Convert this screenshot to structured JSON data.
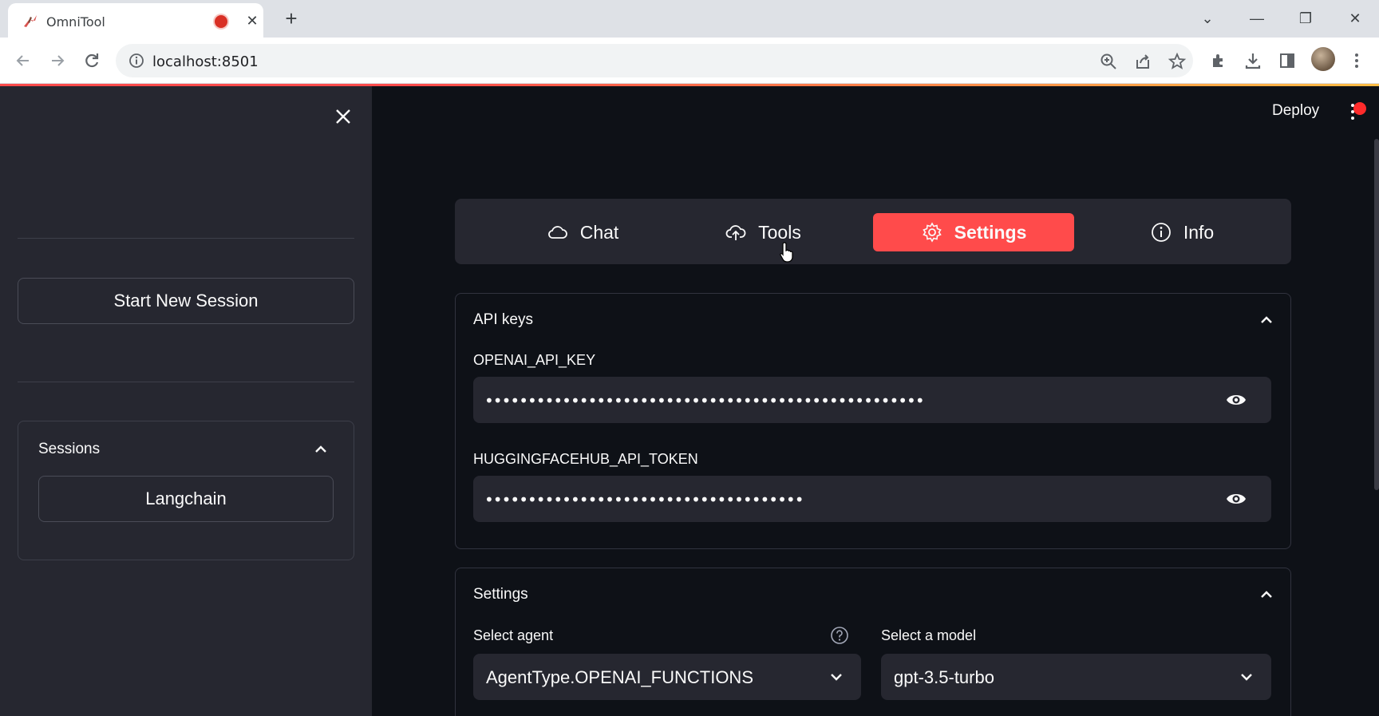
{
  "browser": {
    "tab_title": "OmniTool",
    "tab_close": "✕",
    "new_tab": "+",
    "url": "localhost:8501",
    "window_controls": {
      "tab_search": "⌄",
      "minimize": "—",
      "restore": "❐",
      "close": "✕"
    }
  },
  "sidebar": {
    "close_icon": "close-icon",
    "start_new_session": "Start New Session",
    "sessions": {
      "title": "Sessions",
      "items": [
        "Langchain"
      ]
    }
  },
  "header": {
    "deploy": "Deploy"
  },
  "nav": {
    "active": "Settings",
    "items": [
      {
        "label": "Chat",
        "icon": "cloud-icon"
      },
      {
        "label": "Tools",
        "icon": "cloud-upload-icon"
      },
      {
        "label": "Settings",
        "icon": "gear-icon"
      },
      {
        "label": "Info",
        "icon": "info-icon"
      }
    ]
  },
  "api_keys": {
    "title": "API keys",
    "openai": {
      "label": "OPENAI_API_KEY",
      "value": "•••••••••••••••••••••••••••••••••••••••••••••••••••"
    },
    "huggingface": {
      "label": "HUGGINGFACEHUB_API_TOKEN",
      "value": "•••••••••••••••••••••••••••••••••••••"
    }
  },
  "settings": {
    "title": "Settings",
    "agent": {
      "label": "Select agent",
      "value": "AgentType.OPENAI_FUNCTIONS"
    },
    "model": {
      "label": "Select a model",
      "value": "gpt-3.5-turbo"
    }
  },
  "colors": {
    "accent": "#ff4b4b",
    "background": "#0e1117",
    "sidebar": "#262730"
  }
}
